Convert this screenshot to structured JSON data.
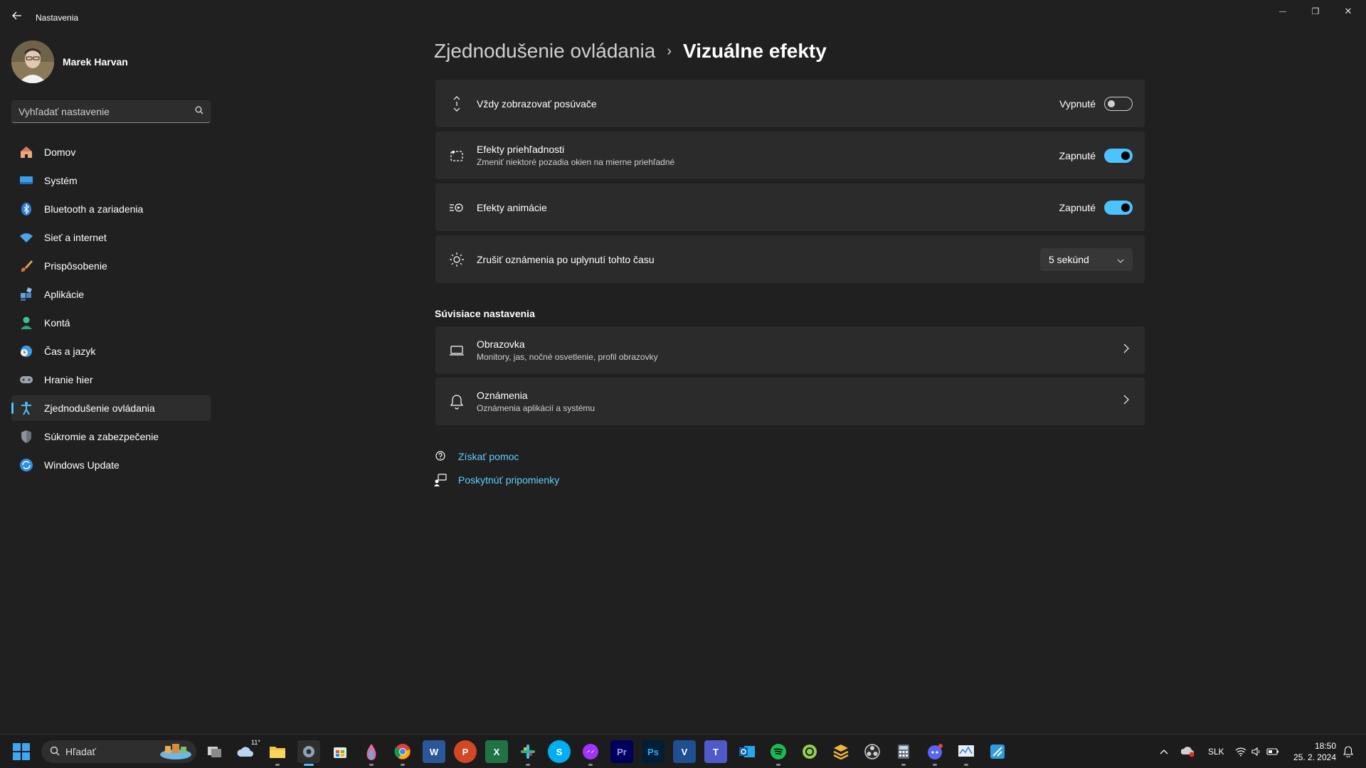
{
  "window": {
    "title": "Nastavenia",
    "minimize_glyph": "—",
    "maximize_glyph": "❐",
    "close_glyph": "✕"
  },
  "profile": {
    "name": "Marek Harvan"
  },
  "search": {
    "placeholder": "Vyhľadať nastavenie"
  },
  "sidebar": {
    "items": [
      {
        "label": "Domov",
        "icon": "home-icon"
      },
      {
        "label": "Systém",
        "icon": "system-icon"
      },
      {
        "label": "Bluetooth a zariadenia",
        "icon": "bluetooth-icon"
      },
      {
        "label": "Sieť a internet",
        "icon": "network-icon"
      },
      {
        "label": "Prispôsobenie",
        "icon": "brush-icon"
      },
      {
        "label": "Aplikácie",
        "icon": "apps-icon"
      },
      {
        "label": "Kontá",
        "icon": "account-icon"
      },
      {
        "label": "Čas a jazyk",
        "icon": "time-language-icon"
      },
      {
        "label": "Hranie hier",
        "icon": "gamepad-icon"
      },
      {
        "label": "Zjednodušenie ovládania",
        "icon": "accessibility-icon",
        "active": true
      },
      {
        "label": "Súkromie a zabezpečenie",
        "icon": "shield-icon"
      },
      {
        "label": "Windows Update",
        "icon": "update-icon"
      }
    ]
  },
  "breadcrumb": {
    "parent": "Zjednodušenie ovládania",
    "separator": "›",
    "current": "Vizuálne efekty"
  },
  "settings": [
    {
      "title": "Vždy zobrazovať posúvače",
      "state_label": "Vypnuté",
      "on": false,
      "icon": "scrollbar-icon"
    },
    {
      "title": "Efekty priehľadnosti",
      "subtitle": "Zmeniť niektoré pozadia okien na mierne priehľadné",
      "state_label": "Zapnuté",
      "on": true,
      "icon": "transparency-icon"
    },
    {
      "title": "Efekty animácie",
      "state_label": "Zapnuté",
      "on": true,
      "icon": "animation-icon"
    },
    {
      "title": "Zrušiť oznámenia po uplynutí tohto času",
      "dropdown_value": "5 sekúnd",
      "icon": "brightness-icon"
    }
  ],
  "related": {
    "title": "Súvisiace nastavenia",
    "items": [
      {
        "title": "Obrazovka",
        "subtitle": "Monitory, jas, nočné osvetlenie, profil obrazovky",
        "icon": "display-icon"
      },
      {
        "title": "Oznámenia",
        "subtitle": "Oznámenia aplikácií a systému",
        "icon": "bell-icon"
      }
    ]
  },
  "links": {
    "help": "Získať pomoc",
    "feedback": "Poskytnúť pripomienky"
  },
  "taskbar": {
    "search_label": "Hľadať",
    "weather_temp": "11°",
    "language": "SLK",
    "time": "18:50",
    "date": "25. 2. 2024",
    "apps": [
      "W",
      "P",
      "X",
      "S",
      "Pr",
      "Ps",
      "V",
      "T"
    ]
  },
  "colors": {
    "accent": "#4cc2ff",
    "background": "#202020",
    "card": "#2b2b2b",
    "link": "#60cdff"
  }
}
